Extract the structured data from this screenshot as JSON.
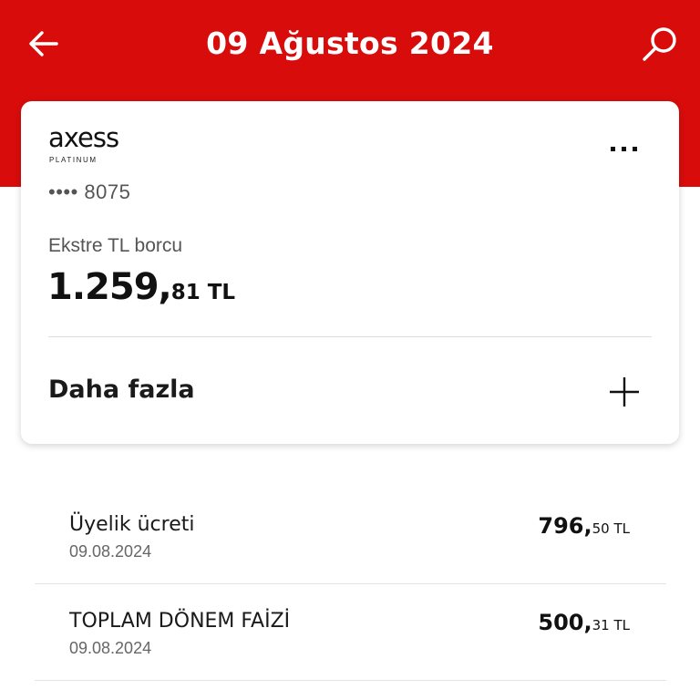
{
  "header": {
    "title": "09 Ağustos 2024",
    "back_icon": "arrow-left-icon",
    "search_icon": "search-icon",
    "color": "#d90c0c"
  },
  "card": {
    "logo_text": "axess",
    "logo_sub": "PLATINUM",
    "number": "•••• 8075",
    "more_icon": "more-dots-icon",
    "debt_label": "Ekstre TL borcu",
    "debt_int": "1.259,",
    "debt_dec": "81 TL",
    "more_label": "Daha fazla",
    "expand_icon": "plus-icon"
  },
  "transactions": [
    {
      "name": "Üyelik ücreti",
      "date": "09.08.2024",
      "amount_int": "796,",
      "amount_dec": "50 TL"
    },
    {
      "name": "TOPLAM DÖNEM FAİZİ",
      "date": "09.08.2024",
      "amount_int": "500,",
      "amount_dec": "31 TL"
    }
  ]
}
